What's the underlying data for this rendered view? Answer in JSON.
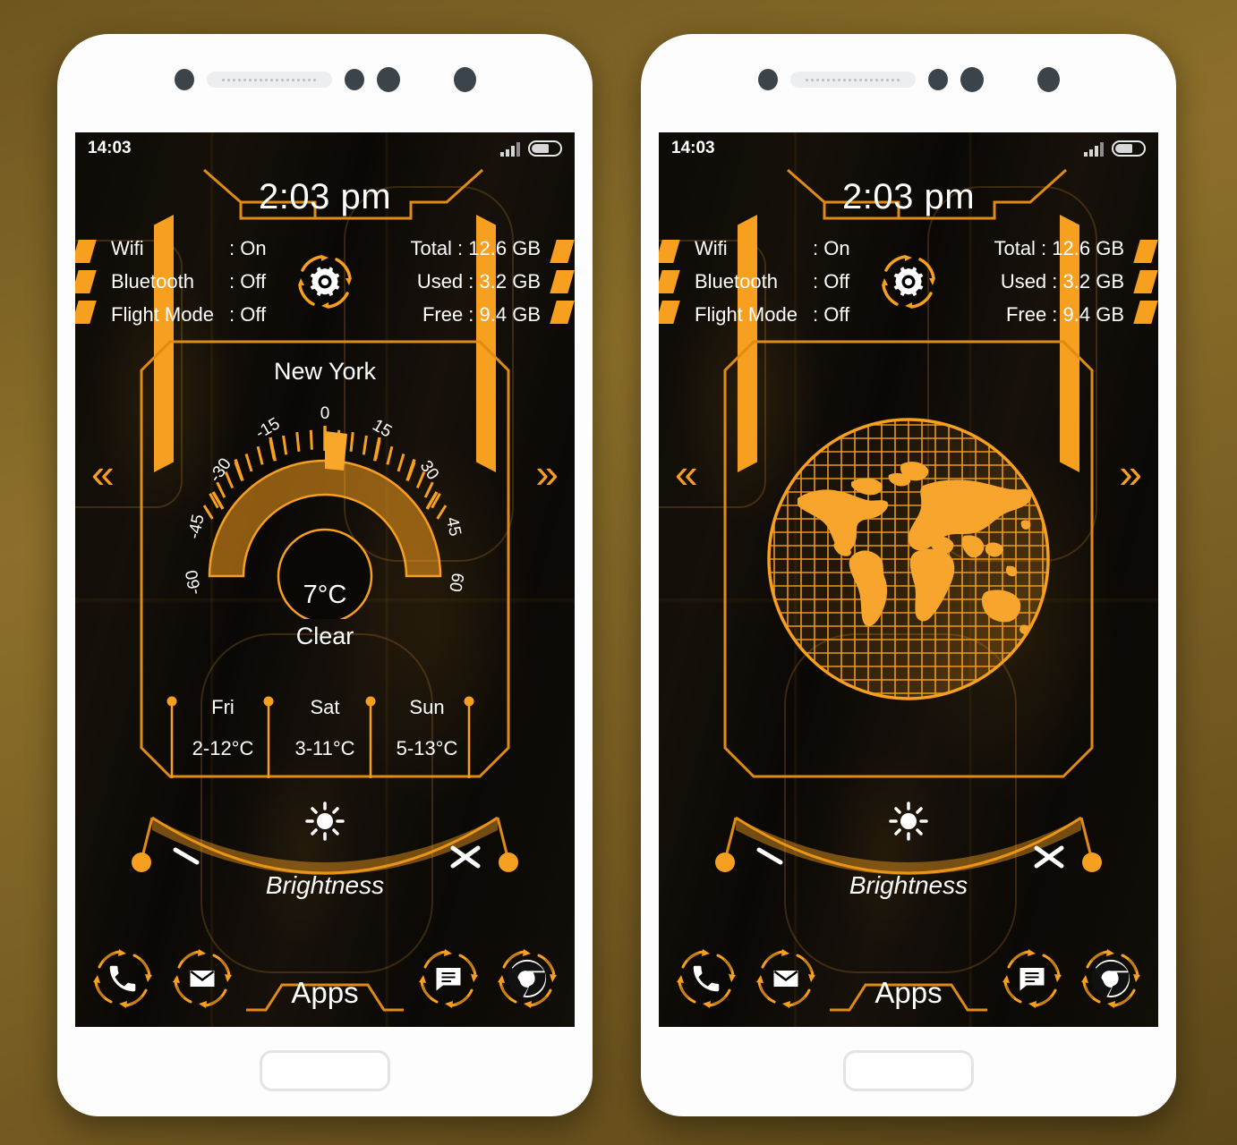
{
  "background": {
    "accent": "#f79f1e",
    "screen_bg": "#090806"
  },
  "phones": [
    {
      "id": "left",
      "view": "weather"
    },
    {
      "id": "right",
      "view": "globe"
    }
  ],
  "status_bar": {
    "time": "14:03",
    "signal_icon": "signal-bars-icon",
    "battery_icon": "battery-icon"
  },
  "clock": {
    "time": "2:03 pm"
  },
  "quick_info": {
    "left_rows": [
      {
        "key": "Wifi",
        "sep": ": On"
      },
      {
        "key": "Bluetooth",
        "sep": ": Off"
      },
      {
        "key": "Flight Mode",
        "sep": ": Off"
      }
    ],
    "right_rows": [
      {
        "text": "Total : 12.6 GB"
      },
      {
        "text": "Used : 3.2 GB"
      },
      {
        "text": "Free : 9.4 GB"
      }
    ],
    "settings_icon": "gear-icon"
  },
  "weather": {
    "city": "New York",
    "temperature": "7°C",
    "condition": "Clear",
    "gauge_ticks": [
      "-60",
      "-45",
      "-30",
      "-15",
      "0",
      "15",
      "30",
      "45",
      "60"
    ],
    "forecast": [
      {
        "day": "Fri",
        "range": "2-12°C"
      },
      {
        "day": "Sat",
        "range": "3-11°C"
      },
      {
        "day": "Sun",
        "range": "5-13°C"
      }
    ]
  },
  "nav": {
    "prev_icon": "chevron-left-double-icon",
    "next_icon": "chevron-right-double-icon",
    "prev": "«",
    "next": "»"
  },
  "globe": {
    "icon": "globe-wireframe-icon"
  },
  "brightness": {
    "label": "Brightness",
    "sun_icon": "sun-icon",
    "min_icon": "minus-icon",
    "max_icon": "close-icon",
    "min_mark": "╲",
    "max_mark": "✕"
  },
  "dock": {
    "apps_label": "Apps",
    "items": [
      {
        "icon": "phone-icon"
      },
      {
        "icon": "mail-icon"
      },
      {
        "icon": "message-icon"
      },
      {
        "icon": "chrome-icon"
      }
    ]
  }
}
